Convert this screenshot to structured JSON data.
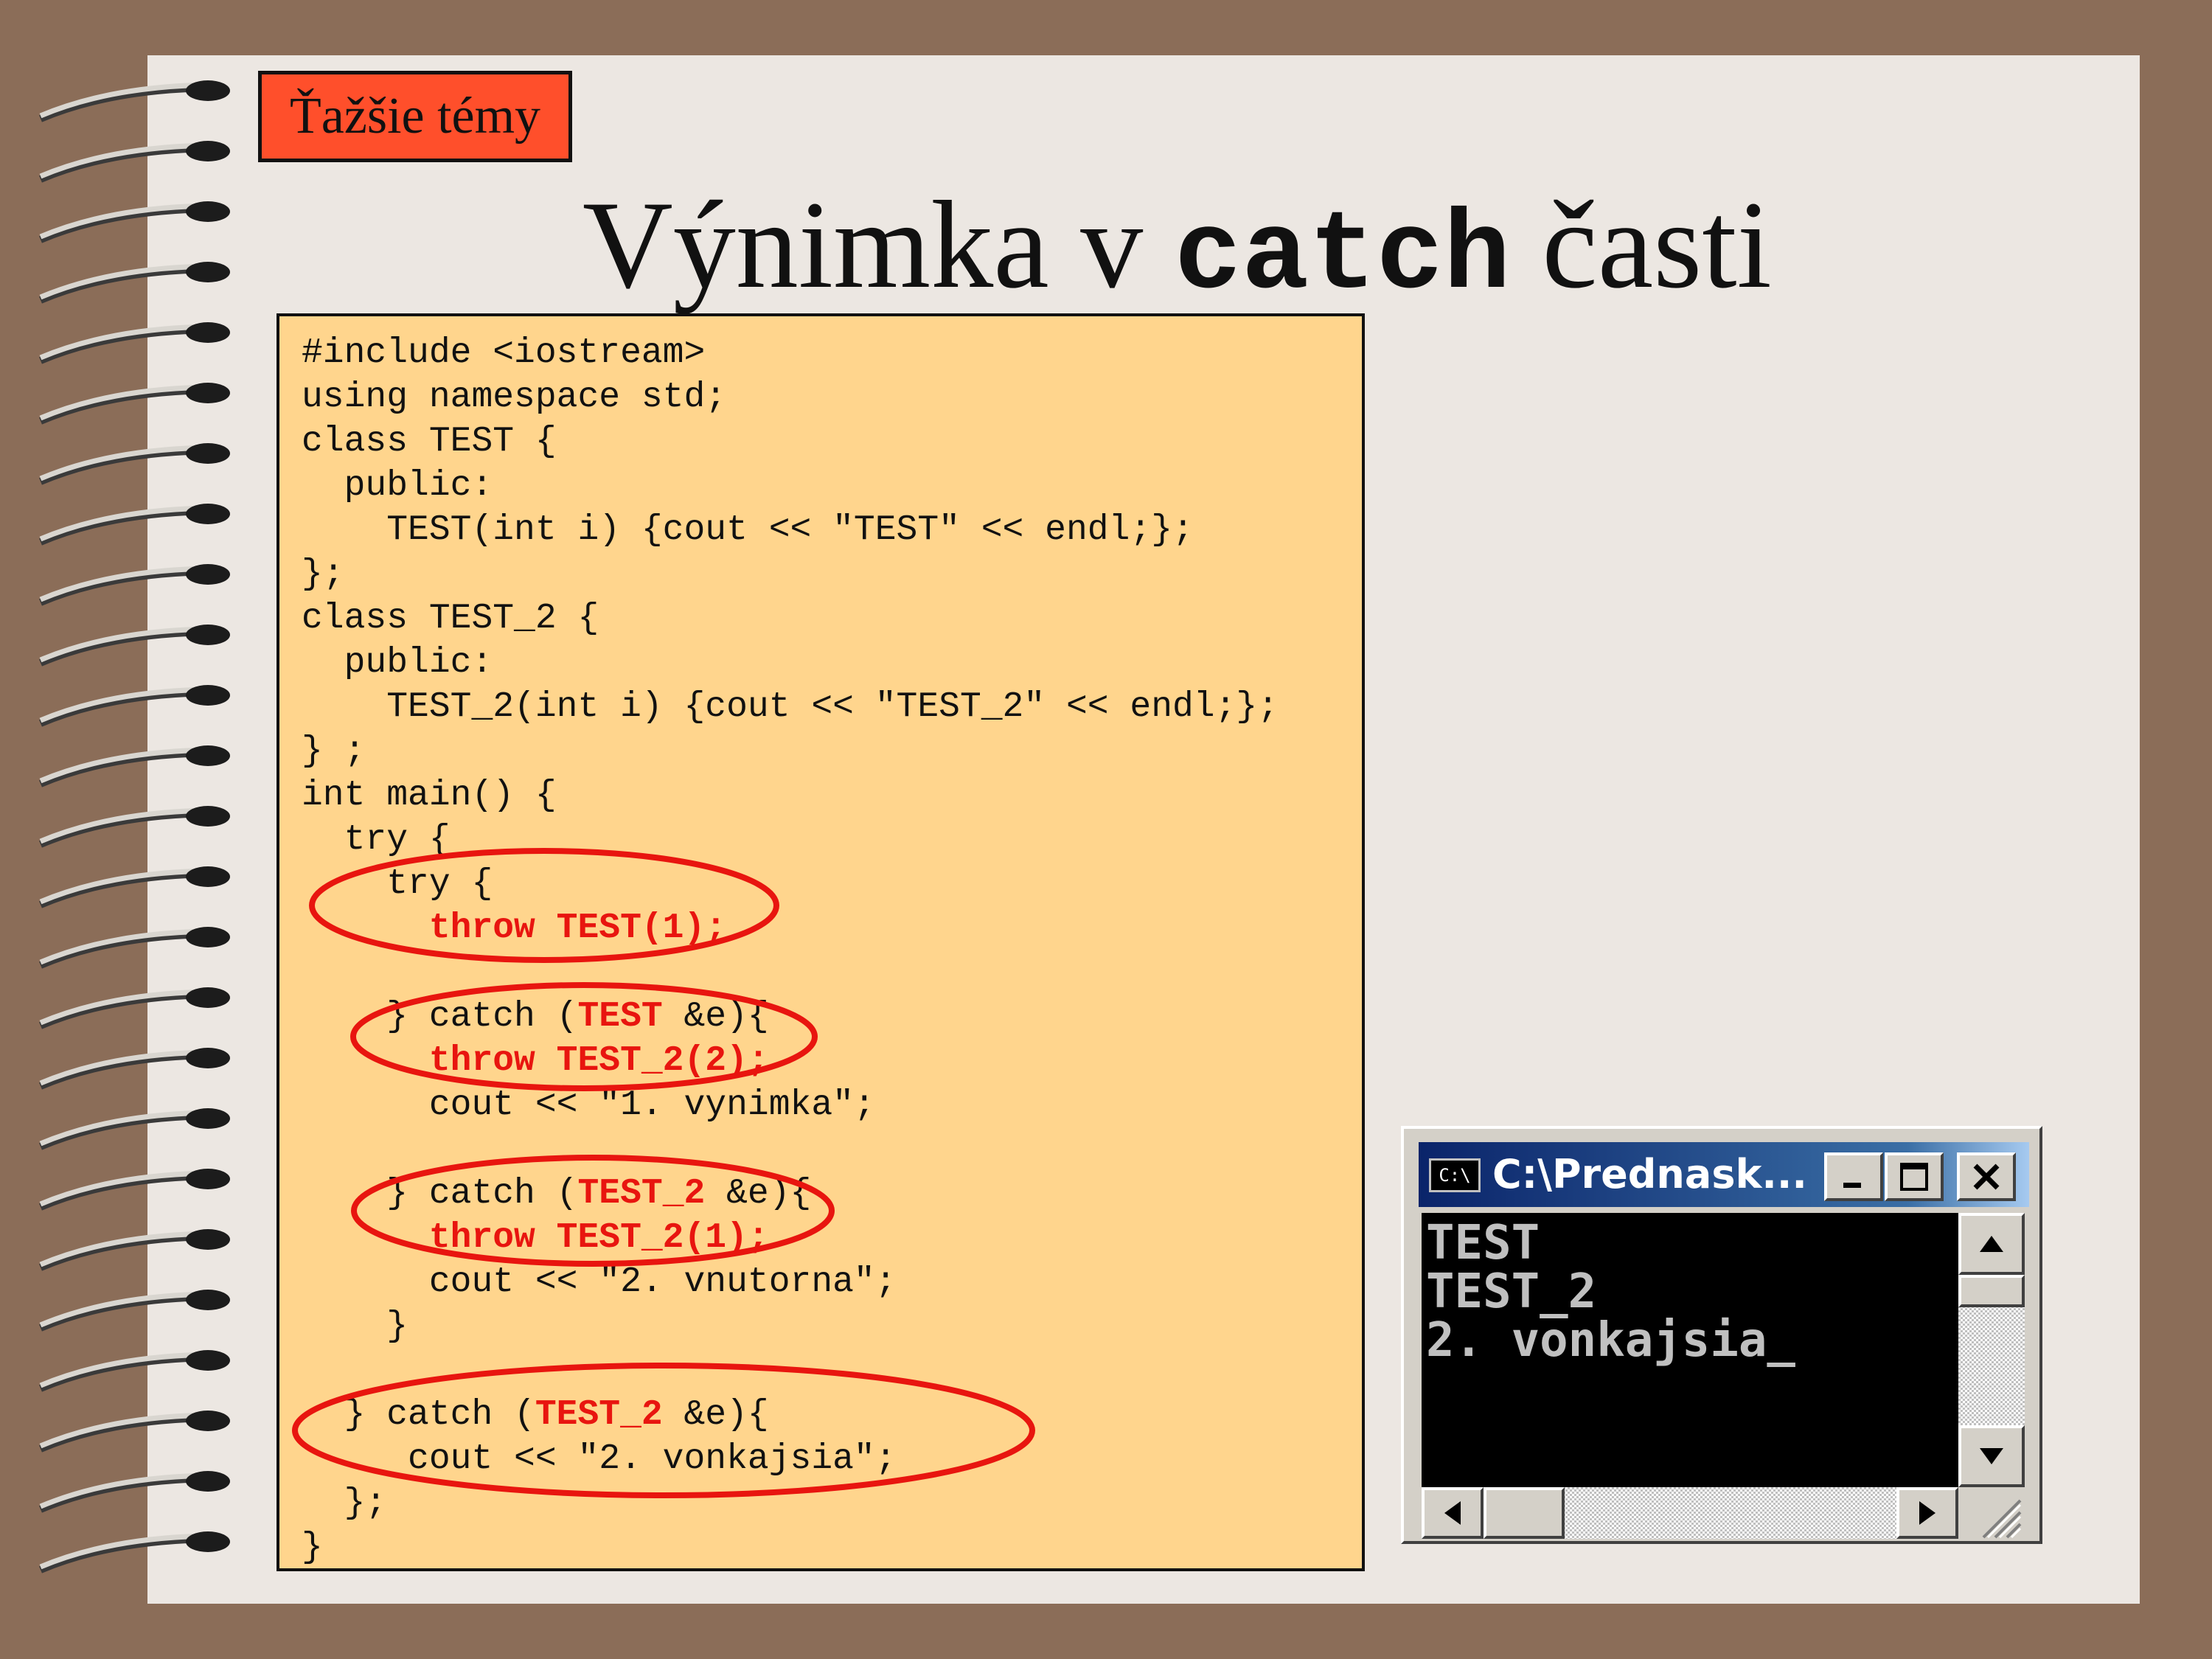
{
  "slide": {
    "topic_badge": "Ťažšie témy",
    "title": {
      "prefix": "Výnimka v ",
      "keyword": "catch",
      "suffix": " časti"
    }
  },
  "code": {
    "lines": [
      [
        {
          "t": "#include <iostream>"
        }
      ],
      [
        {
          "t": "using namespace std;"
        }
      ],
      [
        {
          "t": "class TEST {"
        }
      ],
      [
        {
          "t": "  public:"
        }
      ],
      [
        {
          "t": "    TEST(int i) {cout << \"TEST\" << endl;};"
        }
      ],
      [
        {
          "t": "};"
        }
      ],
      [
        {
          "t": "class TEST_2 {"
        }
      ],
      [
        {
          "t": "  public:"
        }
      ],
      [
        {
          "t": "    TEST_2(int i) {cout << \"TEST_2\" << endl;};"
        }
      ],
      [
        {
          "t": "} ;"
        }
      ],
      [
        {
          "t": "int main() {"
        }
      ],
      [
        {
          "t": "  try {"
        }
      ],
      [
        {
          "t": "    try {"
        }
      ],
      [
        {
          "t": "      "
        },
        {
          "t": "throw TEST(1);",
          "hl": true
        }
      ],
      [
        {
          "t": ""
        }
      ],
      [
        {
          "t": "    } catch ("
        },
        {
          "t": "TEST",
          "hl": true
        },
        {
          "t": " &e){"
        }
      ],
      [
        {
          "t": "      "
        },
        {
          "t": "throw TEST_2(2);",
          "hl": true
        }
      ],
      [
        {
          "t": "      cout << \"1. vynimka\";"
        }
      ],
      [
        {
          "t": ""
        }
      ],
      [
        {
          "t": "    } catch ("
        },
        {
          "t": "TEST_2",
          "hl": true
        },
        {
          "t": " &e){"
        }
      ],
      [
        {
          "t": "      "
        },
        {
          "t": "throw TEST_2(1);",
          "hl": true
        }
      ],
      [
        {
          "t": "      cout << \"2. vnutorna\";"
        }
      ],
      [
        {
          "t": "    }"
        }
      ],
      [
        {
          "t": ""
        }
      ],
      [
        {
          "t": "  } catch ("
        },
        {
          "t": "TEST_2",
          "hl": true
        },
        {
          "t": " &e){"
        }
      ],
      [
        {
          "t": "     cout << \"2. vonkajsia\";"
        }
      ],
      [
        {
          "t": "  };"
        }
      ],
      [
        {
          "t": "}"
        }
      ]
    ],
    "highlight_color": "#e8150f",
    "annotation_color": "#e8150f"
  },
  "console": {
    "icon_label": "C:\\",
    "title": "C:\\Prednask...",
    "output_lines": [
      "TEST",
      "TEST_2",
      "2. vonkajsia_"
    ],
    "icons": {
      "minimize": "minimize-icon",
      "maximize": "maximize-icon",
      "close": "close-icon",
      "scroll_up": "arrow-up-icon",
      "scroll_down": "arrow-down-icon",
      "scroll_left": "arrow-left-icon",
      "scroll_right": "arrow-right-icon",
      "resize_grip": "resize-grip-icon"
    }
  },
  "colors": {
    "background": "#8b6d58",
    "page": "#ece7e2",
    "badge": "#ff4f2b",
    "code_box": "#ffd58d",
    "titlebar": "#0a246a"
  }
}
